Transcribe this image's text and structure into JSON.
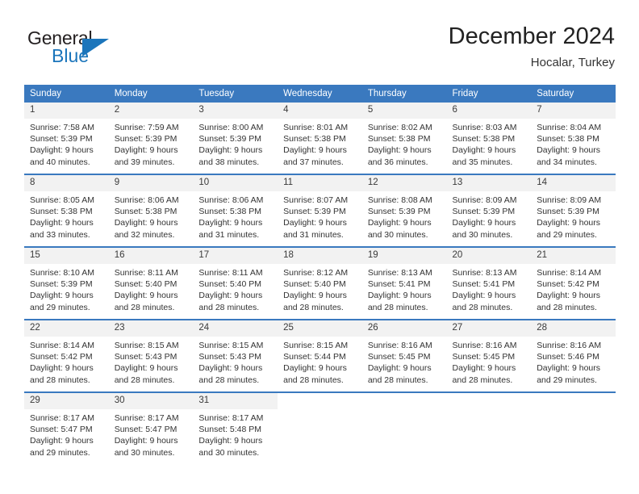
{
  "brand": {
    "name_part1": "General",
    "name_part2": "Blue",
    "accent_color": "#1b75bb",
    "logo_icon": "triangle-flag-icon"
  },
  "header": {
    "title": "December 2024",
    "subtitle": "Hocalar, Turkey"
  },
  "colors": {
    "header_row_bg": "#3a79bf",
    "daynum_bg": "#f2f2f2",
    "text": "#333333"
  },
  "weekday_headers": [
    "Sunday",
    "Monday",
    "Tuesday",
    "Wednesday",
    "Thursday",
    "Friday",
    "Saturday"
  ],
  "weeks": [
    {
      "days": [
        {
          "date": "1",
          "sunrise": "Sunrise: 7:58 AM",
          "sunset": "Sunset: 5:39 PM",
          "daylight_line1": "Daylight: 9 hours",
          "daylight_line2": "and 40 minutes."
        },
        {
          "date": "2",
          "sunrise": "Sunrise: 7:59 AM",
          "sunset": "Sunset: 5:39 PM",
          "daylight_line1": "Daylight: 9 hours",
          "daylight_line2": "and 39 minutes."
        },
        {
          "date": "3",
          "sunrise": "Sunrise: 8:00 AM",
          "sunset": "Sunset: 5:39 PM",
          "daylight_line1": "Daylight: 9 hours",
          "daylight_line2": "and 38 minutes."
        },
        {
          "date": "4",
          "sunrise": "Sunrise: 8:01 AM",
          "sunset": "Sunset: 5:38 PM",
          "daylight_line1": "Daylight: 9 hours",
          "daylight_line2": "and 37 minutes."
        },
        {
          "date": "5",
          "sunrise": "Sunrise: 8:02 AM",
          "sunset": "Sunset: 5:38 PM",
          "daylight_line1": "Daylight: 9 hours",
          "daylight_line2": "and 36 minutes."
        },
        {
          "date": "6",
          "sunrise": "Sunrise: 8:03 AM",
          "sunset": "Sunset: 5:38 PM",
          "daylight_line1": "Daylight: 9 hours",
          "daylight_line2": "and 35 minutes."
        },
        {
          "date": "7",
          "sunrise": "Sunrise: 8:04 AM",
          "sunset": "Sunset: 5:38 PM",
          "daylight_line1": "Daylight: 9 hours",
          "daylight_line2": "and 34 minutes."
        }
      ]
    },
    {
      "days": [
        {
          "date": "8",
          "sunrise": "Sunrise: 8:05 AM",
          "sunset": "Sunset: 5:38 PM",
          "daylight_line1": "Daylight: 9 hours",
          "daylight_line2": "and 33 minutes."
        },
        {
          "date": "9",
          "sunrise": "Sunrise: 8:06 AM",
          "sunset": "Sunset: 5:38 PM",
          "daylight_line1": "Daylight: 9 hours",
          "daylight_line2": "and 32 minutes."
        },
        {
          "date": "10",
          "sunrise": "Sunrise: 8:06 AM",
          "sunset": "Sunset: 5:38 PM",
          "daylight_line1": "Daylight: 9 hours",
          "daylight_line2": "and 31 minutes."
        },
        {
          "date": "11",
          "sunrise": "Sunrise: 8:07 AM",
          "sunset": "Sunset: 5:39 PM",
          "daylight_line1": "Daylight: 9 hours",
          "daylight_line2": "and 31 minutes."
        },
        {
          "date": "12",
          "sunrise": "Sunrise: 8:08 AM",
          "sunset": "Sunset: 5:39 PM",
          "daylight_line1": "Daylight: 9 hours",
          "daylight_line2": "and 30 minutes."
        },
        {
          "date": "13",
          "sunrise": "Sunrise: 8:09 AM",
          "sunset": "Sunset: 5:39 PM",
          "daylight_line1": "Daylight: 9 hours",
          "daylight_line2": "and 30 minutes."
        },
        {
          "date": "14",
          "sunrise": "Sunrise: 8:09 AM",
          "sunset": "Sunset: 5:39 PM",
          "daylight_line1": "Daylight: 9 hours",
          "daylight_line2": "and 29 minutes."
        }
      ]
    },
    {
      "days": [
        {
          "date": "15",
          "sunrise": "Sunrise: 8:10 AM",
          "sunset": "Sunset: 5:39 PM",
          "daylight_line1": "Daylight: 9 hours",
          "daylight_line2": "and 29 minutes."
        },
        {
          "date": "16",
          "sunrise": "Sunrise: 8:11 AM",
          "sunset": "Sunset: 5:40 PM",
          "daylight_line1": "Daylight: 9 hours",
          "daylight_line2": "and 28 minutes."
        },
        {
          "date": "17",
          "sunrise": "Sunrise: 8:11 AM",
          "sunset": "Sunset: 5:40 PM",
          "daylight_line1": "Daylight: 9 hours",
          "daylight_line2": "and 28 minutes."
        },
        {
          "date": "18",
          "sunrise": "Sunrise: 8:12 AM",
          "sunset": "Sunset: 5:40 PM",
          "daylight_line1": "Daylight: 9 hours",
          "daylight_line2": "and 28 minutes."
        },
        {
          "date": "19",
          "sunrise": "Sunrise: 8:13 AM",
          "sunset": "Sunset: 5:41 PM",
          "daylight_line1": "Daylight: 9 hours",
          "daylight_line2": "and 28 minutes."
        },
        {
          "date": "20",
          "sunrise": "Sunrise: 8:13 AM",
          "sunset": "Sunset: 5:41 PM",
          "daylight_line1": "Daylight: 9 hours",
          "daylight_line2": "and 28 minutes."
        },
        {
          "date": "21",
          "sunrise": "Sunrise: 8:14 AM",
          "sunset": "Sunset: 5:42 PM",
          "daylight_line1": "Daylight: 9 hours",
          "daylight_line2": "and 28 minutes."
        }
      ]
    },
    {
      "days": [
        {
          "date": "22",
          "sunrise": "Sunrise: 8:14 AM",
          "sunset": "Sunset: 5:42 PM",
          "daylight_line1": "Daylight: 9 hours",
          "daylight_line2": "and 28 minutes."
        },
        {
          "date": "23",
          "sunrise": "Sunrise: 8:15 AM",
          "sunset": "Sunset: 5:43 PM",
          "daylight_line1": "Daylight: 9 hours",
          "daylight_line2": "and 28 minutes."
        },
        {
          "date": "24",
          "sunrise": "Sunrise: 8:15 AM",
          "sunset": "Sunset: 5:43 PM",
          "daylight_line1": "Daylight: 9 hours",
          "daylight_line2": "and 28 minutes."
        },
        {
          "date": "25",
          "sunrise": "Sunrise: 8:15 AM",
          "sunset": "Sunset: 5:44 PM",
          "daylight_line1": "Daylight: 9 hours",
          "daylight_line2": "and 28 minutes."
        },
        {
          "date": "26",
          "sunrise": "Sunrise: 8:16 AM",
          "sunset": "Sunset: 5:45 PM",
          "daylight_line1": "Daylight: 9 hours",
          "daylight_line2": "and 28 minutes."
        },
        {
          "date": "27",
          "sunrise": "Sunrise: 8:16 AM",
          "sunset": "Sunset: 5:45 PM",
          "daylight_line1": "Daylight: 9 hours",
          "daylight_line2": "and 28 minutes."
        },
        {
          "date": "28",
          "sunrise": "Sunrise: 8:16 AM",
          "sunset": "Sunset: 5:46 PM",
          "daylight_line1": "Daylight: 9 hours",
          "daylight_line2": "and 29 minutes."
        }
      ]
    },
    {
      "days": [
        {
          "date": "29",
          "sunrise": "Sunrise: 8:17 AM",
          "sunset": "Sunset: 5:47 PM",
          "daylight_line1": "Daylight: 9 hours",
          "daylight_line2": "and 29 minutes."
        },
        {
          "date": "30",
          "sunrise": "Sunrise: 8:17 AM",
          "sunset": "Sunset: 5:47 PM",
          "daylight_line1": "Daylight: 9 hours",
          "daylight_line2": "and 30 minutes."
        },
        {
          "date": "31",
          "sunrise": "Sunrise: 8:17 AM",
          "sunset": "Sunset: 5:48 PM",
          "daylight_line1": "Daylight: 9 hours",
          "daylight_line2": "and 30 minutes."
        },
        {
          "date": "",
          "sunrise": "",
          "sunset": "",
          "daylight_line1": "",
          "daylight_line2": ""
        },
        {
          "date": "",
          "sunrise": "",
          "sunset": "",
          "daylight_line1": "",
          "daylight_line2": ""
        },
        {
          "date": "",
          "sunrise": "",
          "sunset": "",
          "daylight_line1": "",
          "daylight_line2": ""
        },
        {
          "date": "",
          "sunrise": "",
          "sunset": "",
          "daylight_line1": "",
          "daylight_line2": ""
        }
      ]
    }
  ]
}
